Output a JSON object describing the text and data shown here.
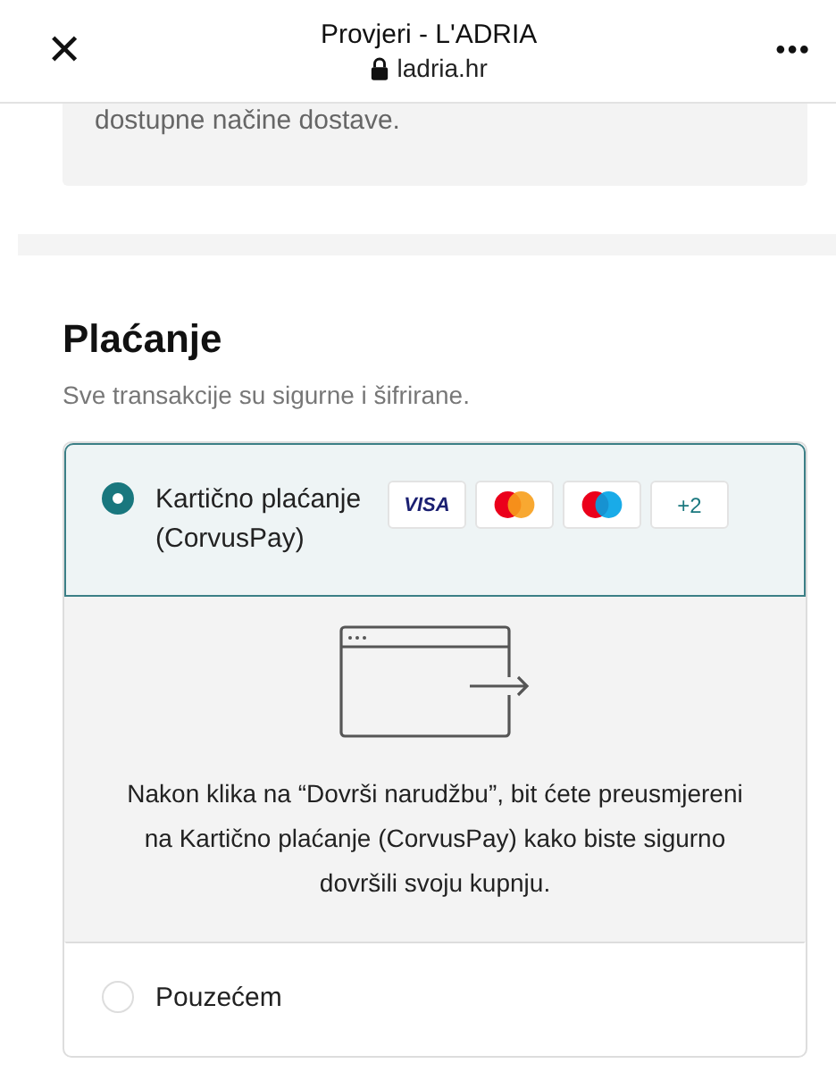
{
  "header": {
    "close": "✕",
    "title": "Provjeri - L'ADRIA",
    "url": "ladria.hr",
    "more": "•••"
  },
  "delivery_note": "dostupne načine dostave.",
  "payment": {
    "title": "Plaćanje",
    "subtitle": "Sve transakcije su sigurne i šifrirane.",
    "options": [
      {
        "label": "Kartično plaćanje (CorvusPay)",
        "selected": true,
        "logos": [
          {
            "kind": "visa",
            "text": "VISA"
          },
          {
            "kind": "mastercard"
          },
          {
            "kind": "maestro"
          },
          {
            "kind": "more",
            "text": "+2"
          }
        ],
        "details": "Nakon klika na “Dovrši narudžbu”, bit ćete preusmjereni na Kartično plaćanje (CorvusPay) kako biste sigurno dovršili svoju kupnju."
      },
      {
        "label": "Pouzećem",
        "selected": false
      }
    ]
  }
}
